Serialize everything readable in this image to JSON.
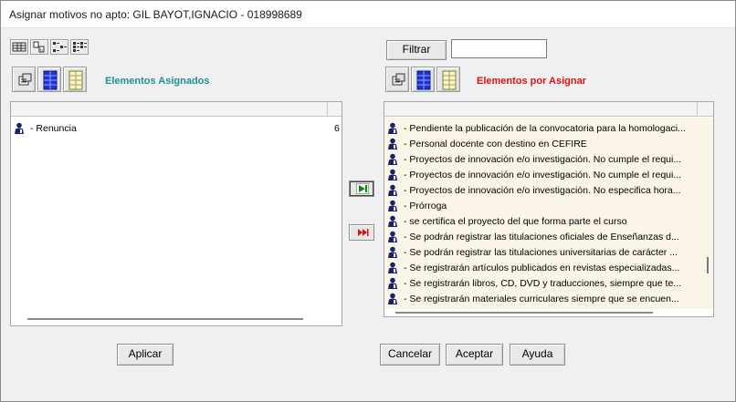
{
  "window": {
    "title": "Asignar motivos no apto: GIL BAYOT,IGNACIO - 018998689"
  },
  "left": {
    "title": "Elementos Asignados",
    "title_color": "#1f8f8f",
    "items": [
      {
        "label": "- Renuncia",
        "value": "6"
      }
    ]
  },
  "right": {
    "title": "Elementos por Asignar",
    "title_color": "#e01010",
    "filter_label": "Filtrar",
    "filter_value": "",
    "items": [
      {
        "label": "- Pendiente la publicación de la convocatoria para la homologaci..."
      },
      {
        "label": "- Personal docente con destino en CEFIRE"
      },
      {
        "label": "- Proyectos de innovación e/o investigación. No cumple el requi..."
      },
      {
        "label": "- Proyectos de innovación e/o investigación. No cumple el requi..."
      },
      {
        "label": "- Proyectos de innovación e/o investigación. No especifica hora..."
      },
      {
        "label": "- Prórroga"
      },
      {
        "label": "- se certifica el proyecto del que forma parte el curso"
      },
      {
        "label": "- Se podrán registrar las titulaciones oficiales de Enseñanzas d..."
      },
      {
        "label": "- Se podrán registrar las titulaciones universitarias de carácter ..."
      },
      {
        "label": "- Se registrarán artículos publicados en revistas especializadas..."
      },
      {
        "label": "- Se registrarán libros, CD, DVD y traducciones, siempre que te..."
      },
      {
        "label": "- Se registrarán materiales curriculares siempre que se encuen..."
      }
    ]
  },
  "buttons": {
    "apply": "Aplicar",
    "cancel": "Cancelar",
    "accept": "Aceptar",
    "help": "Ayuda"
  },
  "icons": {
    "row_icon": "person-icon",
    "assign": "assign-arrow-icon",
    "remove": "remove-arrow-icon"
  }
}
